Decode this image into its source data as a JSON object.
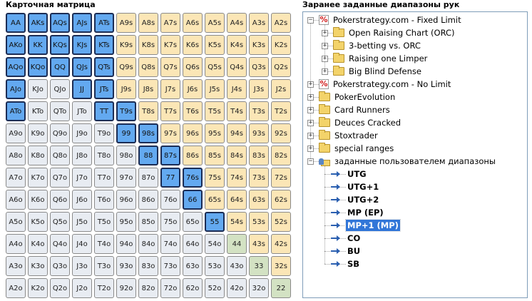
{
  "matrix": {
    "title": "Карточная матрица",
    "ranks": [
      "A",
      "K",
      "Q",
      "J",
      "T",
      "9",
      "8",
      "7",
      "6",
      "5",
      "4",
      "3",
      "2"
    ],
    "selected": [
      "AA",
      "AKs",
      "AQs",
      "AJs",
      "ATs",
      "AKo",
      "KK",
      "KQs",
      "KJs",
      "KTs",
      "AQo",
      "KQo",
      "QQ",
      "QJs",
      "QTs",
      "AJo",
      "JJ",
      "JTs",
      "ATo",
      "TT",
      "T9s",
      "99",
      "98s",
      "88",
      "87s",
      "77",
      "76s",
      "66",
      "55"
    ]
  },
  "ranges": {
    "title": "Заранее заданные диапазоны рук",
    "nodes": [
      {
        "label": "Pokerstrategy.com - Fixed Limit",
        "icon": "ps-icon",
        "level": 0,
        "expander": "minus"
      },
      {
        "label": "Open Raising Chart (ORC)",
        "icon": "folder-icon",
        "level": 1,
        "expander": "plus"
      },
      {
        "label": "3-betting vs. ORC",
        "icon": "folder-icon",
        "level": 1,
        "expander": "plus"
      },
      {
        "label": "Raising one Limper",
        "icon": "folder-icon",
        "level": 1,
        "expander": "plus"
      },
      {
        "label": "Big Blind Defense",
        "icon": "folder-icon",
        "level": 1,
        "expander": "plus"
      },
      {
        "label": "Pokerstrategy.com - No Limit",
        "icon": "ps-icon",
        "level": 0,
        "expander": "plus"
      },
      {
        "label": "PokerEvolution",
        "icon": "folder-icon",
        "level": 0,
        "expander": "plus"
      },
      {
        "label": "Card Runners",
        "icon": "folder-icon",
        "level": 0,
        "expander": "plus"
      },
      {
        "label": "Deuces Cracked",
        "icon": "folder-icon",
        "level": 0,
        "expander": "plus"
      },
      {
        "label": "Stoxtrader",
        "icon": "folder-icon",
        "level": 0,
        "expander": "plus"
      },
      {
        "label": "special ranges",
        "icon": "folder-icon",
        "level": 0,
        "expander": "plus"
      },
      {
        "label": "заданные пользователем диапазоны",
        "icon": "user-folder-icon",
        "level": 0,
        "expander": "minus"
      },
      {
        "label": "UTG",
        "icon": "arrow-right-icon",
        "level": 1,
        "bold": true
      },
      {
        "label": "UTG+1",
        "icon": "arrow-right-icon",
        "level": 1,
        "bold": true
      },
      {
        "label": "UTG+2",
        "icon": "arrow-right-icon",
        "level": 1,
        "bold": true
      },
      {
        "label": "MP (EP)",
        "icon": "arrow-right-icon",
        "level": 1,
        "bold": true
      },
      {
        "label": "MP+1 (MP)",
        "icon": "arrow-right-icon",
        "level": 1,
        "bold": true,
        "selected": true
      },
      {
        "label": "CO",
        "icon": "arrow-right-icon",
        "level": 1,
        "bold": true
      },
      {
        "label": "BU",
        "icon": "arrow-right-icon",
        "level": 1,
        "bold": true
      },
      {
        "label": "SB",
        "icon": "arrow-right-icon",
        "level": 1,
        "bold": true
      }
    ]
  },
  "colors": {
    "selected_cell": "#63a9f0",
    "suited_cell": "#fbe6b6",
    "offsuit_cell": "#e8ecf2",
    "small_pair_cell": "#d3e2c3",
    "tree_selection": "#3176d8"
  }
}
